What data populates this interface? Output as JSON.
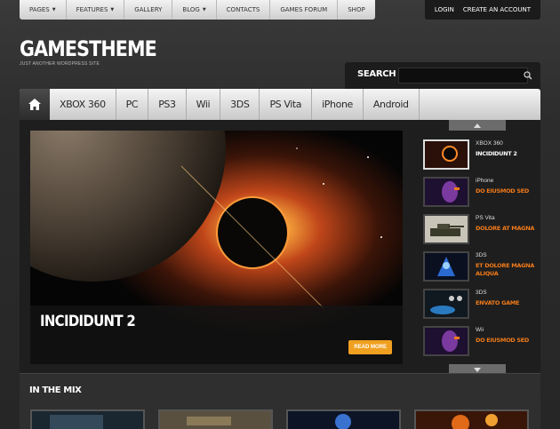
{
  "topnav": {
    "items": [
      {
        "label": "PAGES",
        "caret": "▼"
      },
      {
        "label": "FEATURES",
        "caret": "▼"
      },
      {
        "label": "GALLERY",
        "caret": ""
      },
      {
        "label": "BLOG",
        "caret": "▼"
      },
      {
        "label": "CONTACTS",
        "caret": ""
      },
      {
        "label": "GAMES FORUM",
        "caret": ""
      },
      {
        "label": "SHOP",
        "caret": ""
      }
    ],
    "login": "LOGIN",
    "create_account": "CREATE AN ACCOUNT"
  },
  "logo": {
    "title": "GAMESTHEME",
    "tagline": "JUST ANOTHER WORDPRESS SITE"
  },
  "search": {
    "label": "SEARCH",
    "value": "",
    "icon": "search-icon"
  },
  "mainnav": {
    "home_icon": "home-icon",
    "items": [
      "XBOX 360",
      "PC",
      "PS3",
      "Wii",
      "3DS",
      "PS Vita",
      "iPhone",
      "Android"
    ]
  },
  "hero": {
    "title": "INCIDIDUNT 2",
    "read_more": "READ MORE"
  },
  "sidebar": {
    "items": [
      {
        "category": "XBOX 360",
        "title": "INCIDIDUNT 2",
        "active": true
      },
      {
        "category": "iPhone",
        "title": "DO EIUSMOD SED",
        "active": false
      },
      {
        "category": "PS Vita",
        "title": "DOLORE AT MAGNA",
        "active": false
      },
      {
        "category": "3DS",
        "title": "ET DOLORE MAGNA ALIQUA",
        "active": false
      },
      {
        "category": "3DS",
        "title": "ENVATO GAME",
        "active": false
      },
      {
        "category": "Wii",
        "title": "DO EIUSMOD SED",
        "active": false
      }
    ]
  },
  "mix": {
    "title": "IN THE MIX"
  },
  "colors": {
    "accent_orange": "#f07a1a",
    "readmore_bg": "#f0a020",
    "bar_dark": "#1c1c1c"
  }
}
